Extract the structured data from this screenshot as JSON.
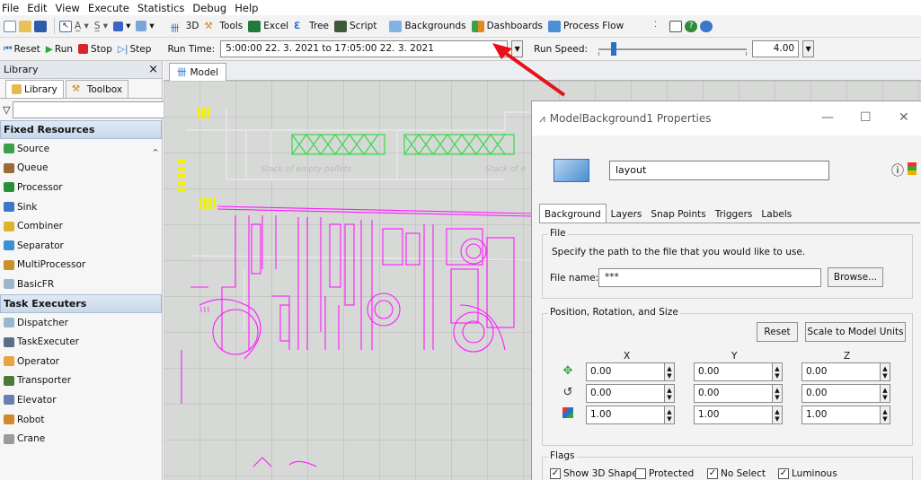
{
  "menu": [
    "File",
    "Edit",
    "View",
    "Execute",
    "Statistics",
    "Debug",
    "Help"
  ],
  "toolbar": {
    "view_3d": "3D",
    "tools": "Tools",
    "excel": "Excel",
    "tree": "Tree",
    "script": "Script",
    "backgrounds": "Backgrounds",
    "dashboards": "Dashboards",
    "process_flow": "Process Flow"
  },
  "run_bar": {
    "reset": "Reset",
    "run": "Run",
    "stop": "Stop",
    "step": "Step",
    "run_time_label": "Run Time:",
    "run_time_value": "5:00:00 22. 3. 2021  to  17:05:00 22. 3. 2021",
    "run_speed_label": "Run Speed:",
    "run_speed_value": "4.00"
  },
  "library": {
    "title": "Library",
    "close": "×",
    "tabs": [
      "Library",
      "Toolbox"
    ],
    "groups": [
      {
        "label": "Fixed Resources",
        "items": [
          "Source",
          "Queue",
          "Processor",
          "Sink",
          "Combiner",
          "Separator",
          "MultiProcessor",
          "BasicFR"
        ]
      },
      {
        "label": "Task Executers",
        "items": [
          "Dispatcher",
          "TaskExecuter",
          "Operator",
          "Transporter",
          "Elevator",
          "Robot",
          "Crane"
        ]
      }
    ]
  },
  "model_tab": "Model",
  "model_labels": {
    "pallets_left": "Stack of empty pallets",
    "pallets_right": "Stack of e"
  },
  "dialog": {
    "title": "ModelBackground1 Properties",
    "name": "layout",
    "tabs": [
      "Background",
      "Layers",
      "Snap Points",
      "Triggers",
      "Labels"
    ],
    "file_legend": "File",
    "file_hint": "Specify the path to the file that you would like to use.",
    "file_name_label": "File name:",
    "file_name_value": "***",
    "browse": "Browse...",
    "prs_legend": "Position, Rotation, and Size",
    "reset": "Reset",
    "scale": "Scale to Model Units",
    "axes": [
      "X",
      "Y",
      "Z"
    ],
    "position": [
      "0.00",
      "0.00",
      "0.00"
    ],
    "rotation": [
      "0.00",
      "0.00",
      "0.00"
    ],
    "size": [
      "1.00",
      "1.00",
      "1.00"
    ],
    "flags_legend": "Flags",
    "flags": [
      {
        "label": "Show 3D Shape",
        "checked": true
      },
      {
        "label": "Protected",
        "checked": false
      },
      {
        "label": "No Select",
        "checked": true
      },
      {
        "label": "Luminous",
        "checked": true
      }
    ]
  },
  "colors": {
    "layout_lines": "#ff1aff",
    "pallets": "#37d94a",
    "arrow": "#e8101a",
    "selection": "#2a6fc8"
  }
}
